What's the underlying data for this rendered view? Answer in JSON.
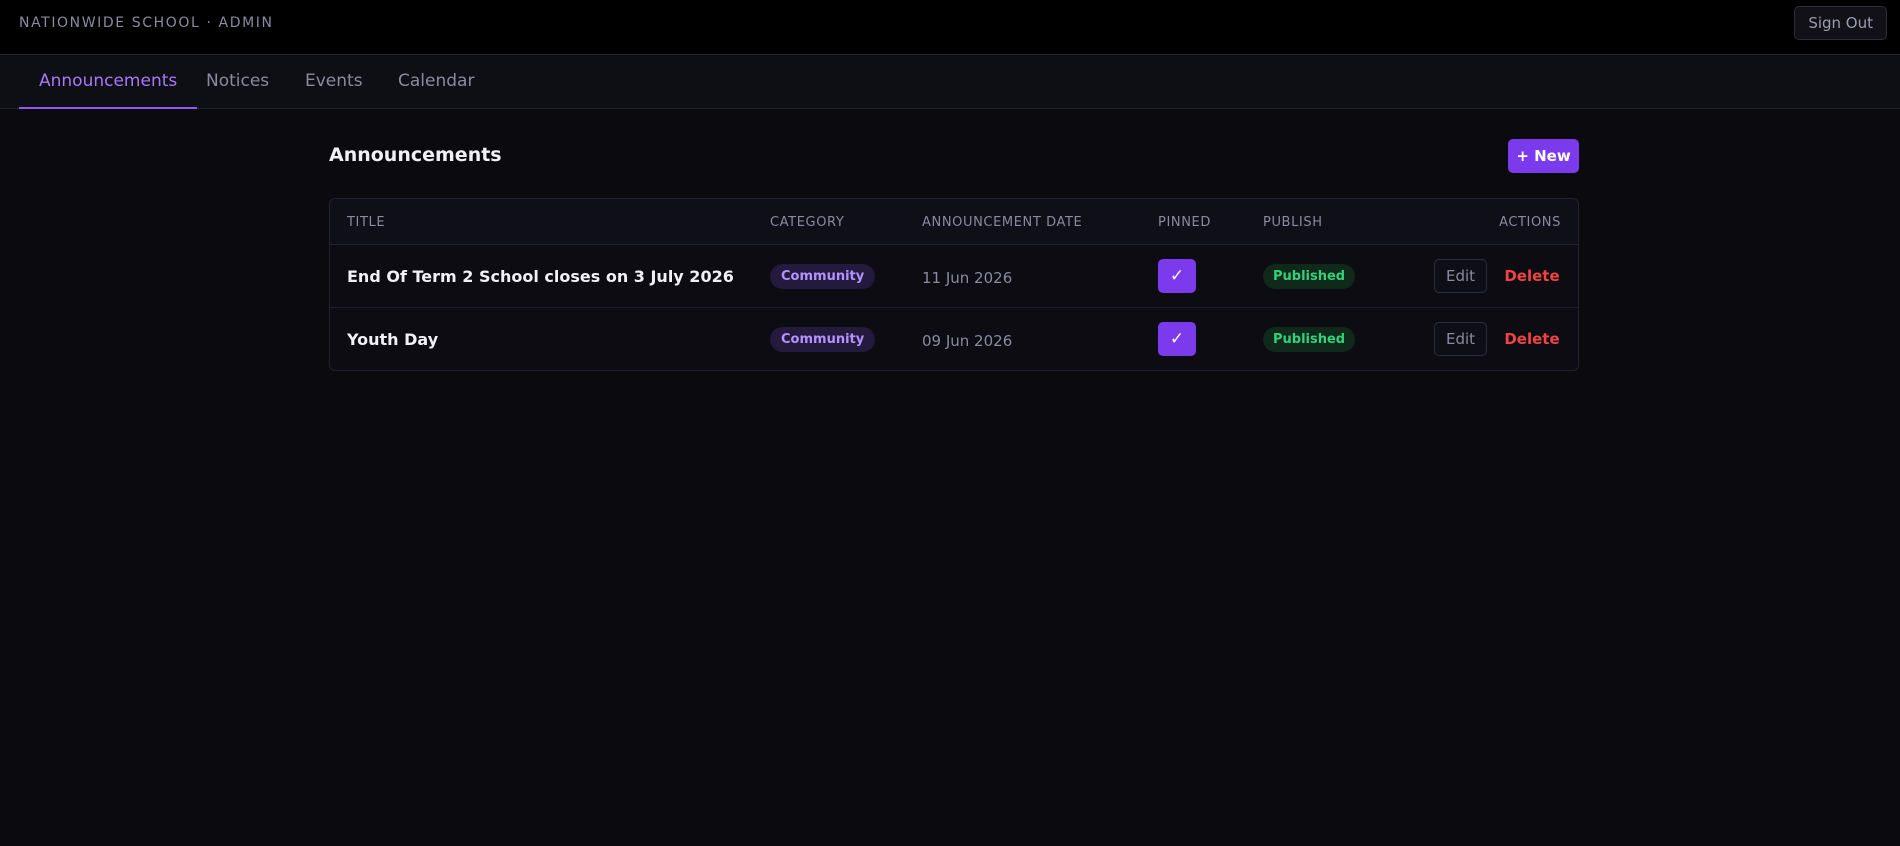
{
  "header": {
    "brand": "NATIONWIDE SCHOOL · ADMIN",
    "sign_out_label": "Sign Out"
  },
  "tabs": [
    {
      "label": "Announcements",
      "active": true
    },
    {
      "label": "Notices",
      "active": false
    },
    {
      "label": "Events",
      "active": false
    },
    {
      "label": "Calendar",
      "active": false
    }
  ],
  "main": {
    "title": "Announcements",
    "new_button_label": "+ New"
  },
  "table": {
    "columns": [
      "TITLE",
      "CATEGORY",
      "ANNOUNCEMENT DATE",
      "PINNED",
      "PUBLISH",
      "ACTIONS"
    ],
    "rows": [
      {
        "title": "End Of Term 2 School closes on 3 July 2026",
        "category": "Community",
        "date": "11 Jun 2026",
        "pinned_icon": "✓",
        "publish": "Published",
        "edit_label": "Edit",
        "delete_label": "Delete"
      },
      {
        "title": "Youth Day",
        "category": "Community",
        "date": "09 Jun 2026",
        "pinned_icon": "✓",
        "publish": "Published",
        "edit_label": "Edit",
        "delete_label": "Delete"
      }
    ]
  },
  "colors": {
    "accent": "#7c3aed",
    "tab_active": "#a779f7",
    "published": "#34d07a",
    "delete": "#ef4444",
    "background": "#0a0a0f"
  }
}
